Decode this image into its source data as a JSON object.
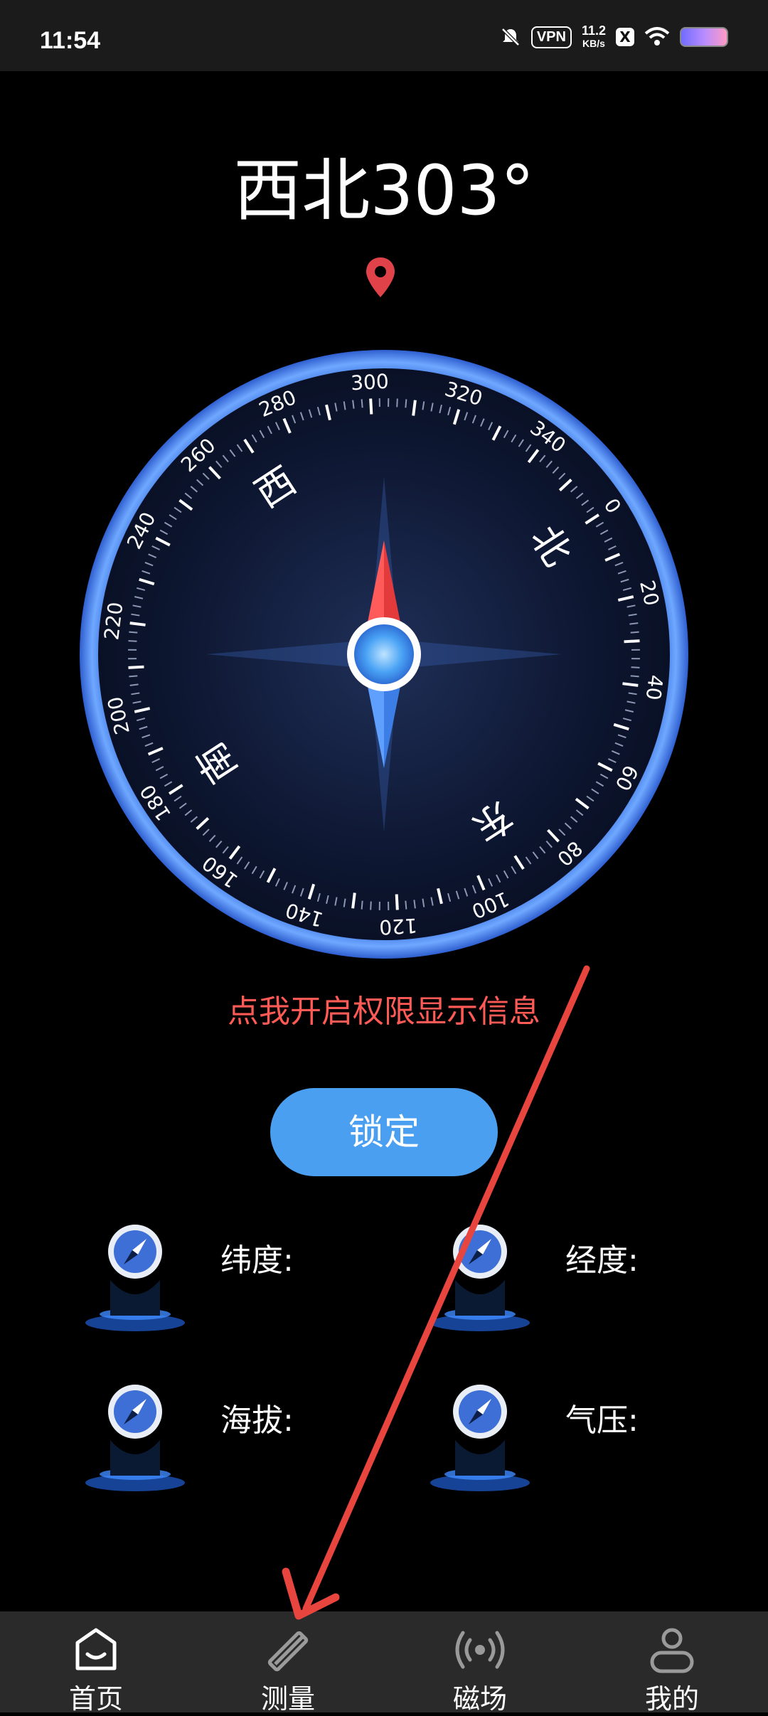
{
  "status_bar": {
    "time": "11:54",
    "vpn": "VPN",
    "speed_value": "11.2",
    "speed_unit": "KB/s",
    "app_badge": "X"
  },
  "compass": {
    "heading_text": "西北303°",
    "heading_degrees": 303,
    "tick_labels": [
      "0",
      "20",
      "40",
      "60",
      "80",
      "100",
      "120",
      "140",
      "160",
      "180",
      "200",
      "220",
      "240",
      "260",
      "280",
      "300",
      "320",
      "340"
    ],
    "cardinals": {
      "north": "北",
      "east": "东",
      "south": "南",
      "west": "西"
    }
  },
  "permission_text": "点我开启权限显示信息",
  "lock_button": "锁定",
  "info": {
    "latitude_label": "纬度:",
    "longitude_label": "经度:",
    "altitude_label": "海拔:",
    "pressure_label": "气压:"
  },
  "nav": {
    "home": "首页",
    "measure": "测量",
    "magnetic": "磁场",
    "mine": "我的"
  },
  "colors": {
    "accent": "#4a9ff0",
    "warning_text": "#ff5a55",
    "ring": "#3d7ef0",
    "needle_north": "#e33b3b",
    "needle_south": "#3d7ee6"
  }
}
